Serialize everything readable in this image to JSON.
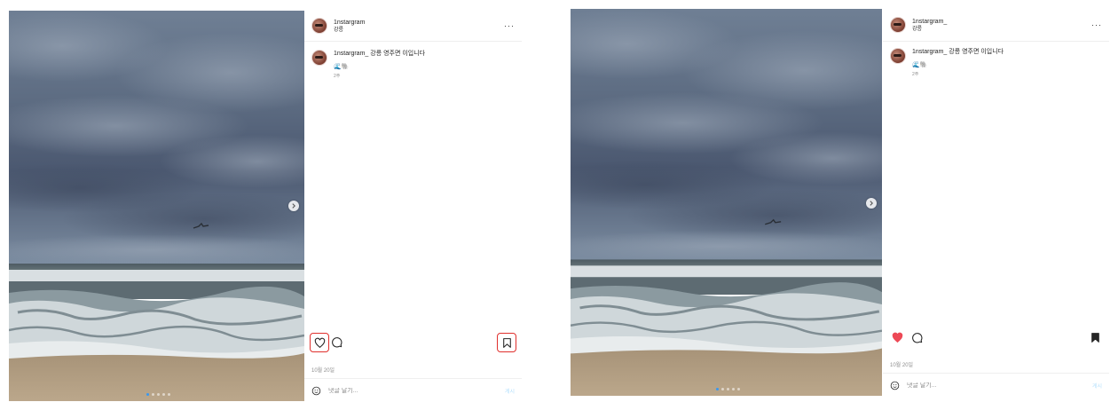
{
  "posts": [
    {
      "username": "1nstargram",
      "location": "강릉",
      "more": "···",
      "caption_user": "1nstargram_",
      "caption_text": "강릉 영주면 이입니다",
      "emojis": "🌊🐘",
      "time_ago": "2주",
      "date": "10월 20일",
      "comment_placeholder": "댓글 달기...",
      "post_label": "게시",
      "liked": false,
      "saved": false
    },
    {
      "username": "1nstargram_",
      "location": "강릉",
      "more": "···",
      "caption_user": "1nstargram_",
      "caption_text": "강릉 영주면 이입니다",
      "emojis": "🌊🐘",
      "time_ago": "2주",
      "date": "10월 20일",
      "comment_placeholder": "댓글 달기...",
      "post_label": "게시",
      "liked": true,
      "saved": true
    }
  ],
  "colors": {
    "like_red": "#ed4956",
    "highlight": "#e0302d",
    "dot_active": "#3897f0",
    "post_disabled": "#b2dffc"
  },
  "icons": [
    "chevron-right-icon",
    "heart-icon",
    "comment-icon",
    "bookmark-icon",
    "emoji-smile-icon",
    "more-options-icon"
  ],
  "carousel": {
    "count": 5,
    "current": 1
  }
}
